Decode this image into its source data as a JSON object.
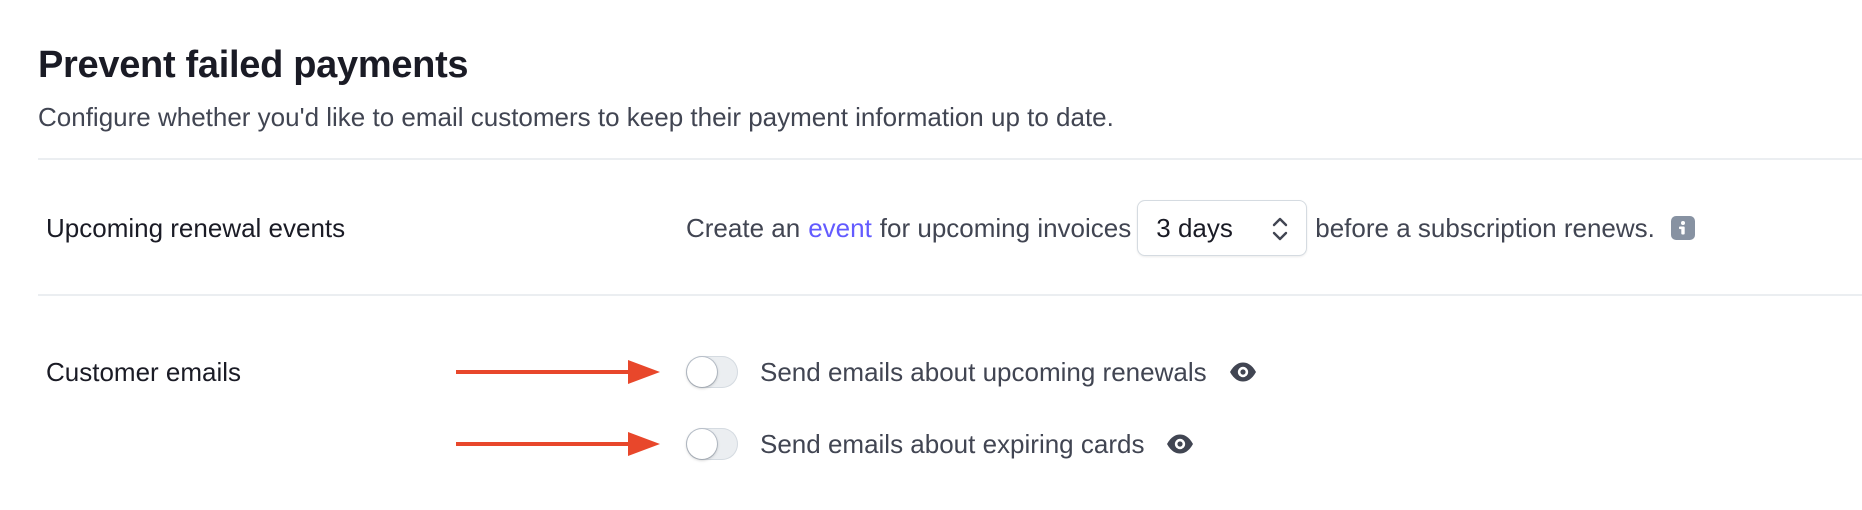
{
  "header": {
    "title": "Prevent failed payments",
    "subtitle": "Configure whether you'd like to email customers to keep their payment information up to date."
  },
  "renewal": {
    "label": "Upcoming renewal events",
    "text_before_link": "Create an",
    "link": "event",
    "text_after_link": "for upcoming invoices",
    "select_value": "3 days",
    "text_after_select": "before a subscription renews.",
    "info_icon": "info-icon"
  },
  "customer_emails": {
    "label": "Customer emails",
    "options": [
      {
        "label": "Send emails about upcoming renewals",
        "enabled": false,
        "icon": "eye-icon"
      },
      {
        "label": "Send emails about expiring cards",
        "enabled": false,
        "icon": "eye-icon"
      }
    ]
  },
  "annotation": {
    "arrow_color": "#e8472b"
  },
  "colors": {
    "link": "#635bff",
    "text_primary": "#1a1b25",
    "text_secondary": "#414552"
  }
}
